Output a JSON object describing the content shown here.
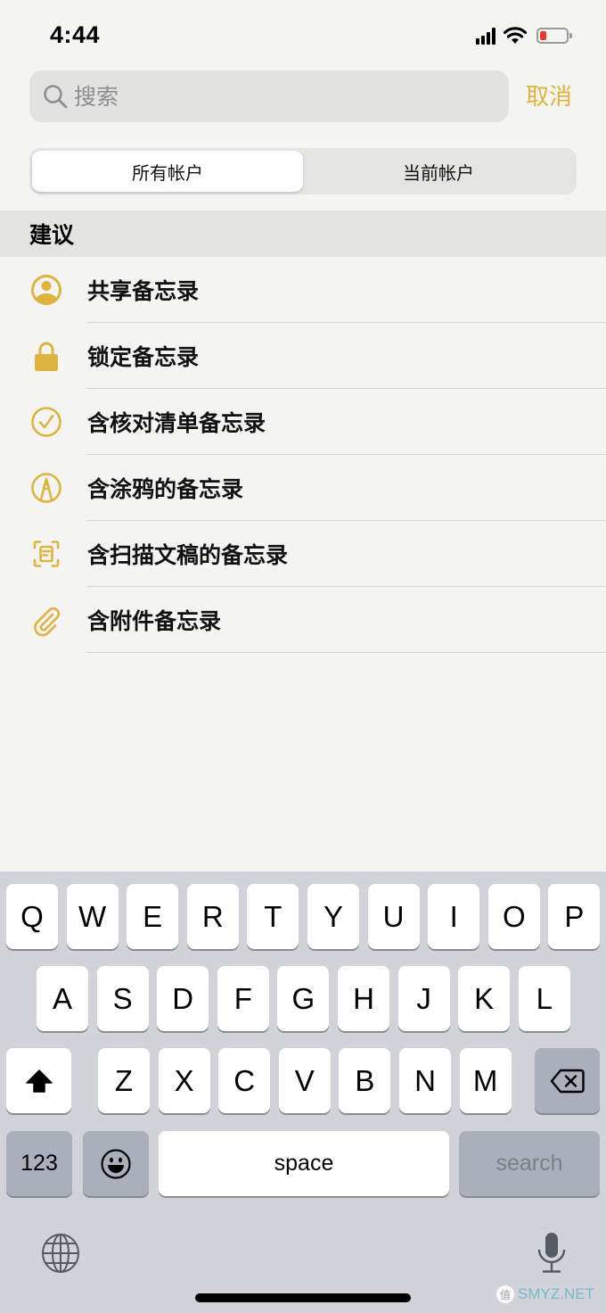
{
  "status_bar": {
    "time": "4:44",
    "icons": [
      "cellular-signal-icon",
      "wifi-icon",
      "battery-low-icon"
    ],
    "battery_color": "#e8392f"
  },
  "search": {
    "placeholder": "搜索",
    "value": "",
    "cancel_label": "取消",
    "accent_color": "#e0b33a"
  },
  "scope": {
    "options": [
      "所有帐户",
      "当前帐户"
    ],
    "selected": "所有帐户"
  },
  "suggestions": {
    "header": "建议",
    "items": [
      {
        "label": "共享备忘录",
        "icon": "shared-person-icon"
      },
      {
        "label": "锁定备忘录",
        "icon": "lock-icon"
      },
      {
        "label": "含核对清单备忘录",
        "icon": "checkmark-circle-icon"
      },
      {
        "label": "含涂鸦的备忘录",
        "icon": "pencil-tip-circle-icon"
      },
      {
        "label": "含扫描文稿的备忘录",
        "icon": "document-scan-icon"
      },
      {
        "label": "含附件备忘录",
        "icon": "paperclip-icon"
      }
    ]
  },
  "keyboard": {
    "row1": [
      "Q",
      "W",
      "E",
      "R",
      "T",
      "Y",
      "U",
      "I",
      "O",
      "P"
    ],
    "row2": [
      "A",
      "S",
      "D",
      "F",
      "G",
      "H",
      "J",
      "K",
      "L"
    ],
    "row3": [
      "Z",
      "X",
      "C",
      "V",
      "B",
      "N",
      "M"
    ],
    "numbers_label": "123",
    "space_label": "space",
    "return_label": "search"
  },
  "watermark": {
    "badge": "值",
    "text": "SMYZ.NET"
  }
}
